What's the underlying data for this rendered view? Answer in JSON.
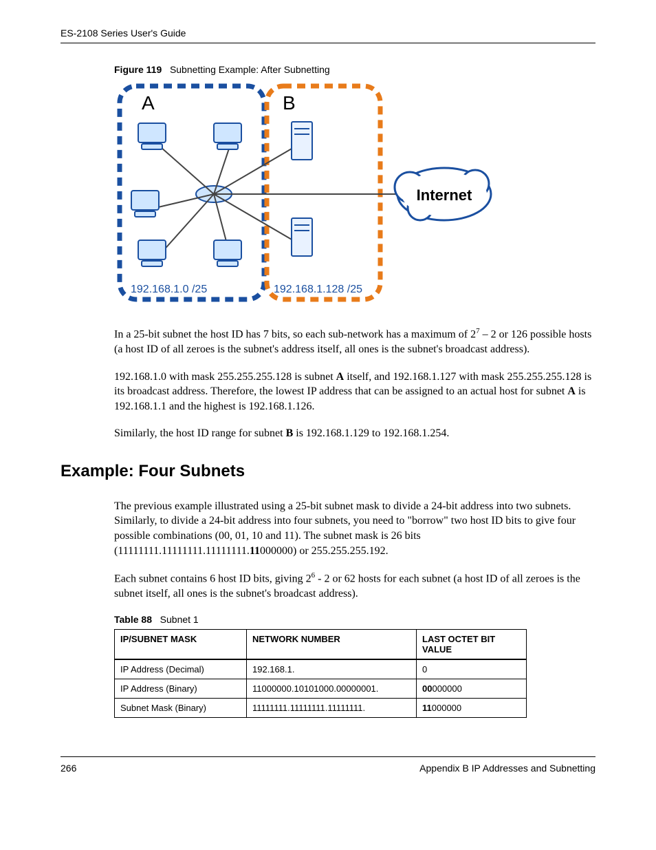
{
  "header": {
    "guide_title": "ES-2108 Series User's Guide"
  },
  "figure": {
    "label": "Figure 119",
    "title": "Subnetting Example: After Subnetting",
    "group_a": "A",
    "group_b": "B",
    "ip_a": "192.168.1.0 /25",
    "ip_b": "192.168.1.128 /25",
    "internet": "Internet"
  },
  "para1_pre": "In a 25-bit subnet the host ID has 7 bits, so each sub-network has a maximum of 2",
  "para1_sup": "7",
  "para1_post": " – 2 or 126 possible hosts (a host ID of all zeroes is the subnet's address itself, all ones is the subnet's broadcast address).",
  "para2_a": "192.168.1.0 with mask 255.255.255.128 is subnet ",
  "para2_b": " itself, and 192.168.1.127 with mask 255.255.255.128 is its broadcast address. Therefore, the lowest IP address that can be assigned to an actual host for subnet ",
  "para2_c": " is 192.168.1.1 and the highest is 192.168.1.126.",
  "bold_A": "A",
  "para3_a": "Similarly, the host ID range for subnet ",
  "bold_B": "B",
  "para3_b": " is 192.168.1.129 to 192.168.1.254.",
  "section_heading": "Example: Four Subnets",
  "para4_a": "The previous example illustrated using a 25-bit subnet mask to divide a 24-bit address into two subnets. Similarly, to divide a 24-bit address into four subnets, you need to \"borrow\" two host ID bits to give four possible combinations (00, 01, 10 and 11). The subnet mask is 26 bits (11111111.11111111.11111111.",
  "para4_bold": "11",
  "para4_b": "000000) or 255.255.255.192.",
  "para5_a": "Each subnet contains 6 host ID bits, giving 2",
  "para5_sup": "6",
  "para5_b": " - 2 or 62 hosts for each subnet (a host ID of all zeroes is the subnet itself, all ones is the subnet's broadcast address).",
  "table": {
    "label": "Table 88",
    "title": "Subnet 1",
    "headers": [
      "IP/SUBNET MASK",
      "NETWORK NUMBER",
      "LAST OCTET BIT VALUE"
    ],
    "rows": [
      {
        "c0": "IP Address (Decimal)",
        "c1": "192.168.1.",
        "c2a": "",
        "c2b": "0"
      },
      {
        "c0": "IP Address (Binary)",
        "c1": "11000000.10101000.00000001.",
        "c2a": "00",
        "c2b": "000000"
      },
      {
        "c0": "Subnet Mask (Binary)",
        "c1": "11111111.11111111.11111111.",
        "c2a": "11",
        "c2b": "000000"
      }
    ]
  },
  "footer": {
    "page_num": "266",
    "appendix": "Appendix B IP Addresses and Subnetting"
  }
}
